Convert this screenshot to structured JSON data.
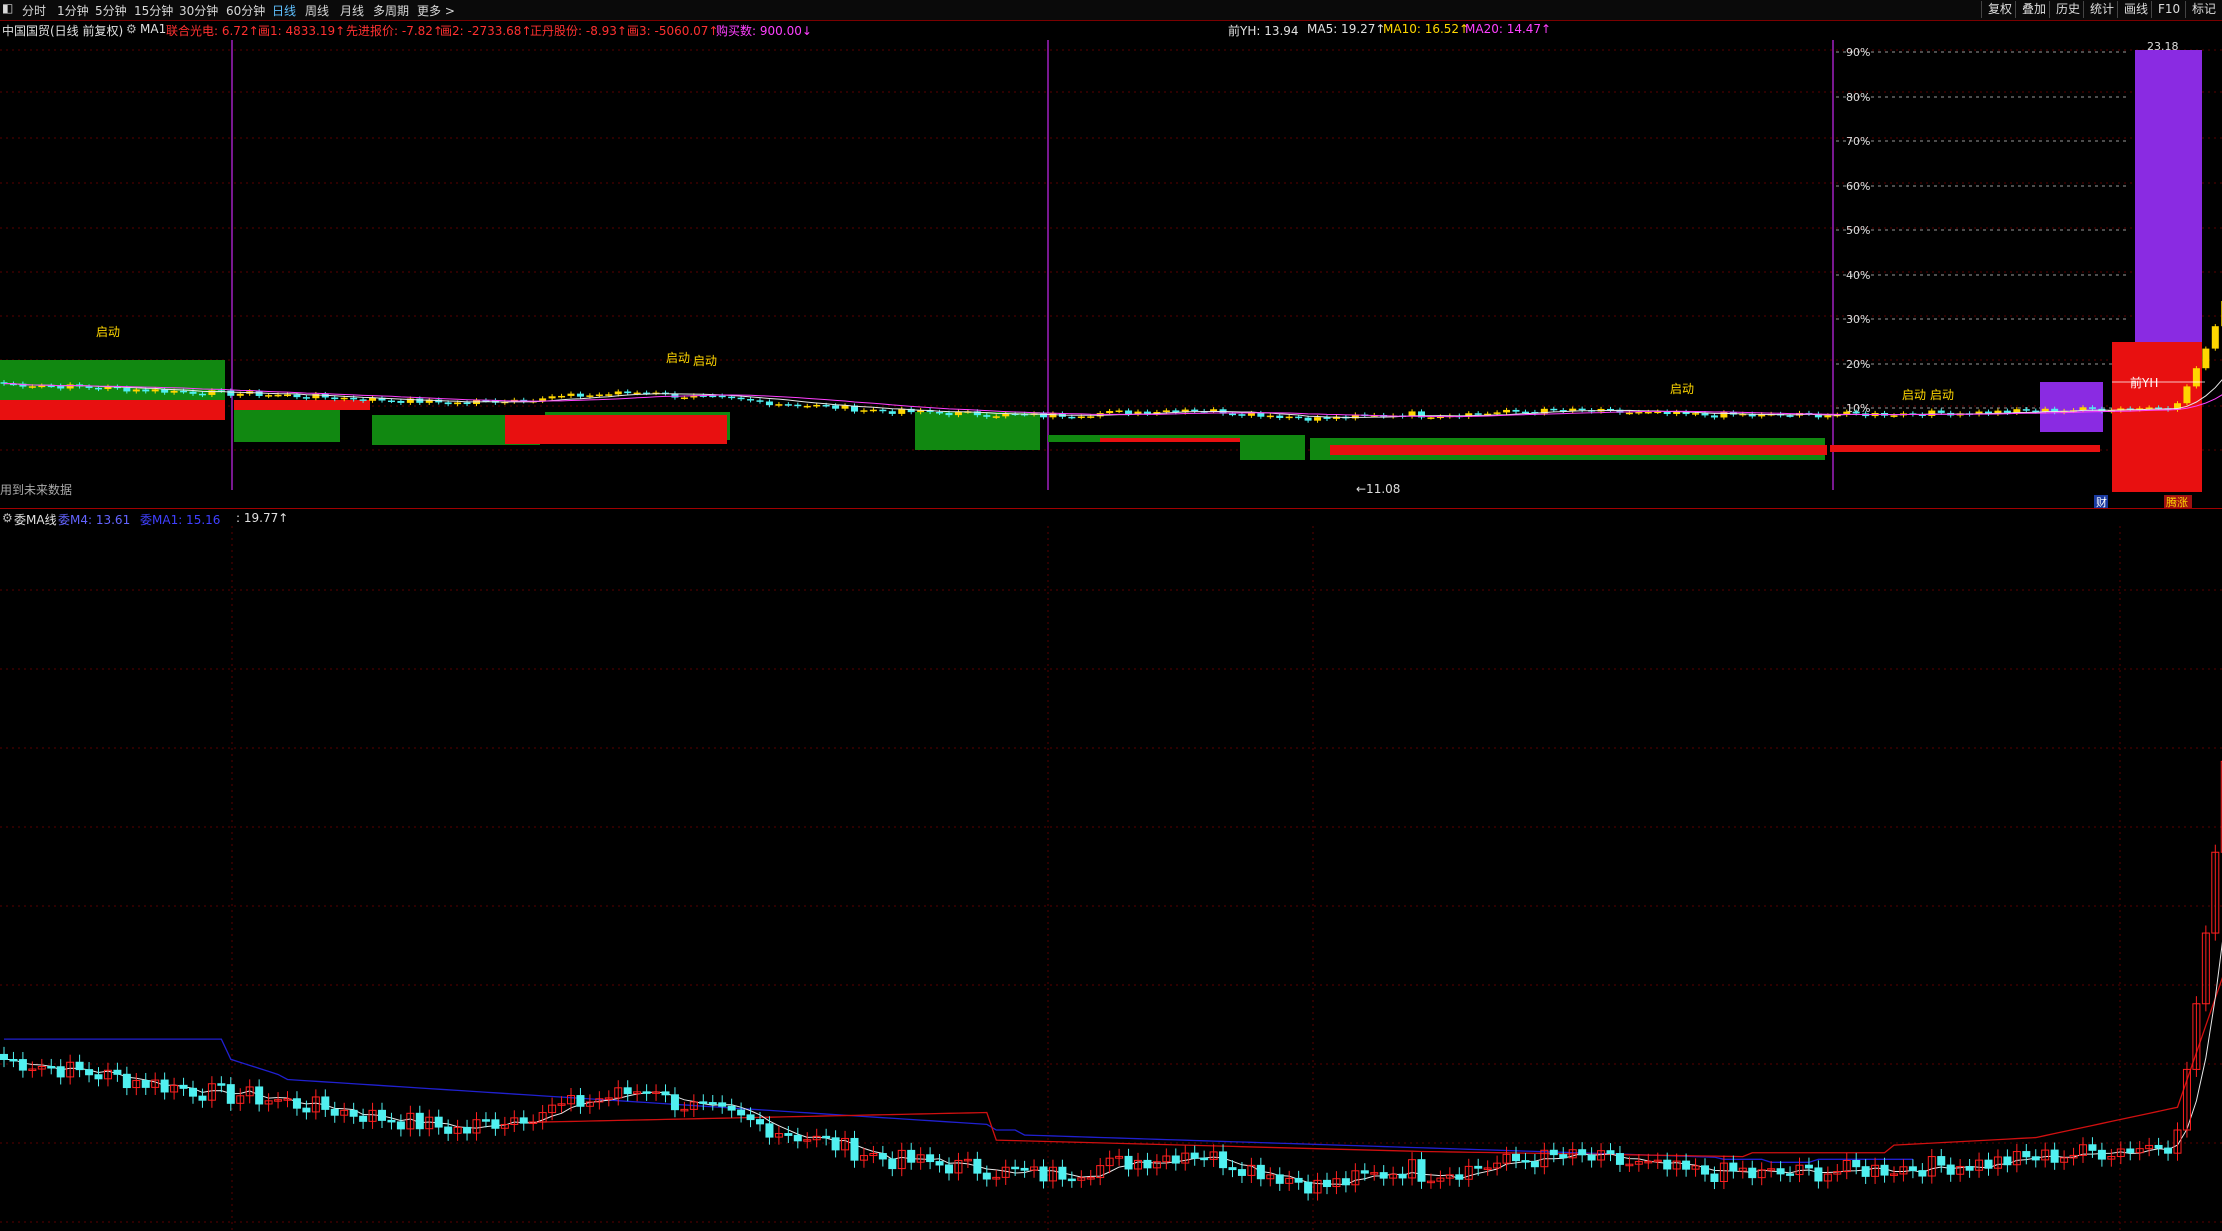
{
  "toolbar": {
    "periods": [
      "分时",
      "1分钟",
      "5分钟",
      "15分钟",
      "30分钟",
      "60分钟",
      "日线",
      "周线",
      "月线",
      "多周期",
      "更多 >"
    ],
    "active_index": 6,
    "right_buttons": [
      "复权",
      "叠加",
      "历史",
      "统计",
      "画线",
      "F10",
      "标记"
    ]
  },
  "infobar": {
    "stock": "中国国贸(日线 前复权)",
    "ma_label": "MA1",
    "indicators": [
      {
        "text": "联合光电: 6.72↑",
        "color": "#ff3030"
      },
      {
        "text": "画1: 4833.19↑",
        "color": "#ff3030"
      },
      {
        "text": "先进报价: -7.82↑",
        "color": "#ff3030"
      },
      {
        "text": "画2: -2733.68↑",
        "color": "#ff3030"
      },
      {
        "text": "正丹股份: -8.93↑",
        "color": "#ff3030"
      },
      {
        "text": "画3: -5060.07↑",
        "color": "#ff3030"
      },
      {
        "text": "购买数: 900.00↓",
        "color": "#ff40ff"
      }
    ],
    "ma_values": [
      {
        "text": "前YH: 13.94",
        "color": "#e0e0e0"
      },
      {
        "text": "MA5: 19.27↑",
        "color": "#e0e0e0"
      },
      {
        "text": "MA10: 16.52↑",
        "color": "#ffd700"
      },
      {
        "text": "MA20: 14.47↑",
        "color": "#ff40ff"
      }
    ]
  },
  "upper": {
    "pct_labels": [
      "90%",
      "80%",
      "70%",
      "60%",
      "50%",
      "40%",
      "30%",
      "20%",
      "10%"
    ],
    "qidong_labels": [
      "启动",
      "启动",
      "启动",
      "启动",
      "启动",
      "启动"
    ],
    "low_label": "←11.08",
    "high_label": "23.18",
    "qian_yh": "前YH",
    "future_note": "用到未来数据",
    "badge_cai": "财",
    "badge_zhang": "腾涨"
  },
  "lower": {
    "title": "委MA线",
    "items": [
      {
        "text": "委M4: 13.61",
        "color": "#6464ff"
      },
      {
        "text": "委MA1: 15.16",
        "color": "#4040ff"
      },
      {
        "text": ": 19.77↑",
        "color": "#e0e0e0"
      }
    ]
  },
  "colors": {
    "up": "#ff2020",
    "down": "#50f0f0",
    "yellow": "#ffd700",
    "green": "#118811",
    "red_block": "#e81010",
    "purple": "#8a2be2",
    "blue_line": "#2020d0",
    "red_line": "#d01010"
  }
}
